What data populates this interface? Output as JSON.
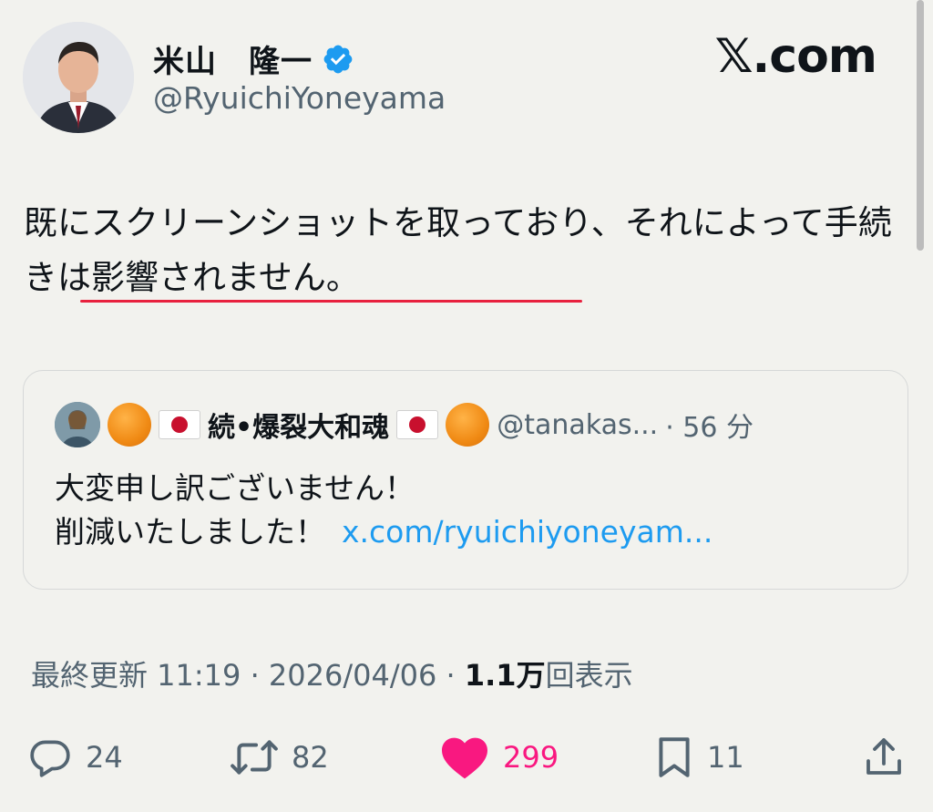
{
  "brand": "𝕏.com",
  "author": {
    "name": "米山　隆一",
    "handle": "@RyuichiYoneyama",
    "verified": true
  },
  "tweet": {
    "text": "既にスクリーンショットを取っており、それによって手続きは影響されません。"
  },
  "quote": {
    "name": "続•爆裂大和魂",
    "handle": "@tanakas...",
    "time": "· 56 分",
    "line1": "大変申し訳ございません！",
    "line2": "削減いたしました！",
    "link": "x.com/ryuichiyoneyam..."
  },
  "meta": {
    "prefix": "最終更新 11:19 · 2026/04/06 ·",
    "views_count": "1.1万",
    "views_label": "回表示"
  },
  "actions": {
    "replies": "24",
    "retweets": "82",
    "likes": "299",
    "bookmarks": "11"
  },
  "colors": {
    "like": "#f91880",
    "link": "#1d9bf0",
    "verified": "#1d9bf0",
    "underline": "#e8213e"
  }
}
